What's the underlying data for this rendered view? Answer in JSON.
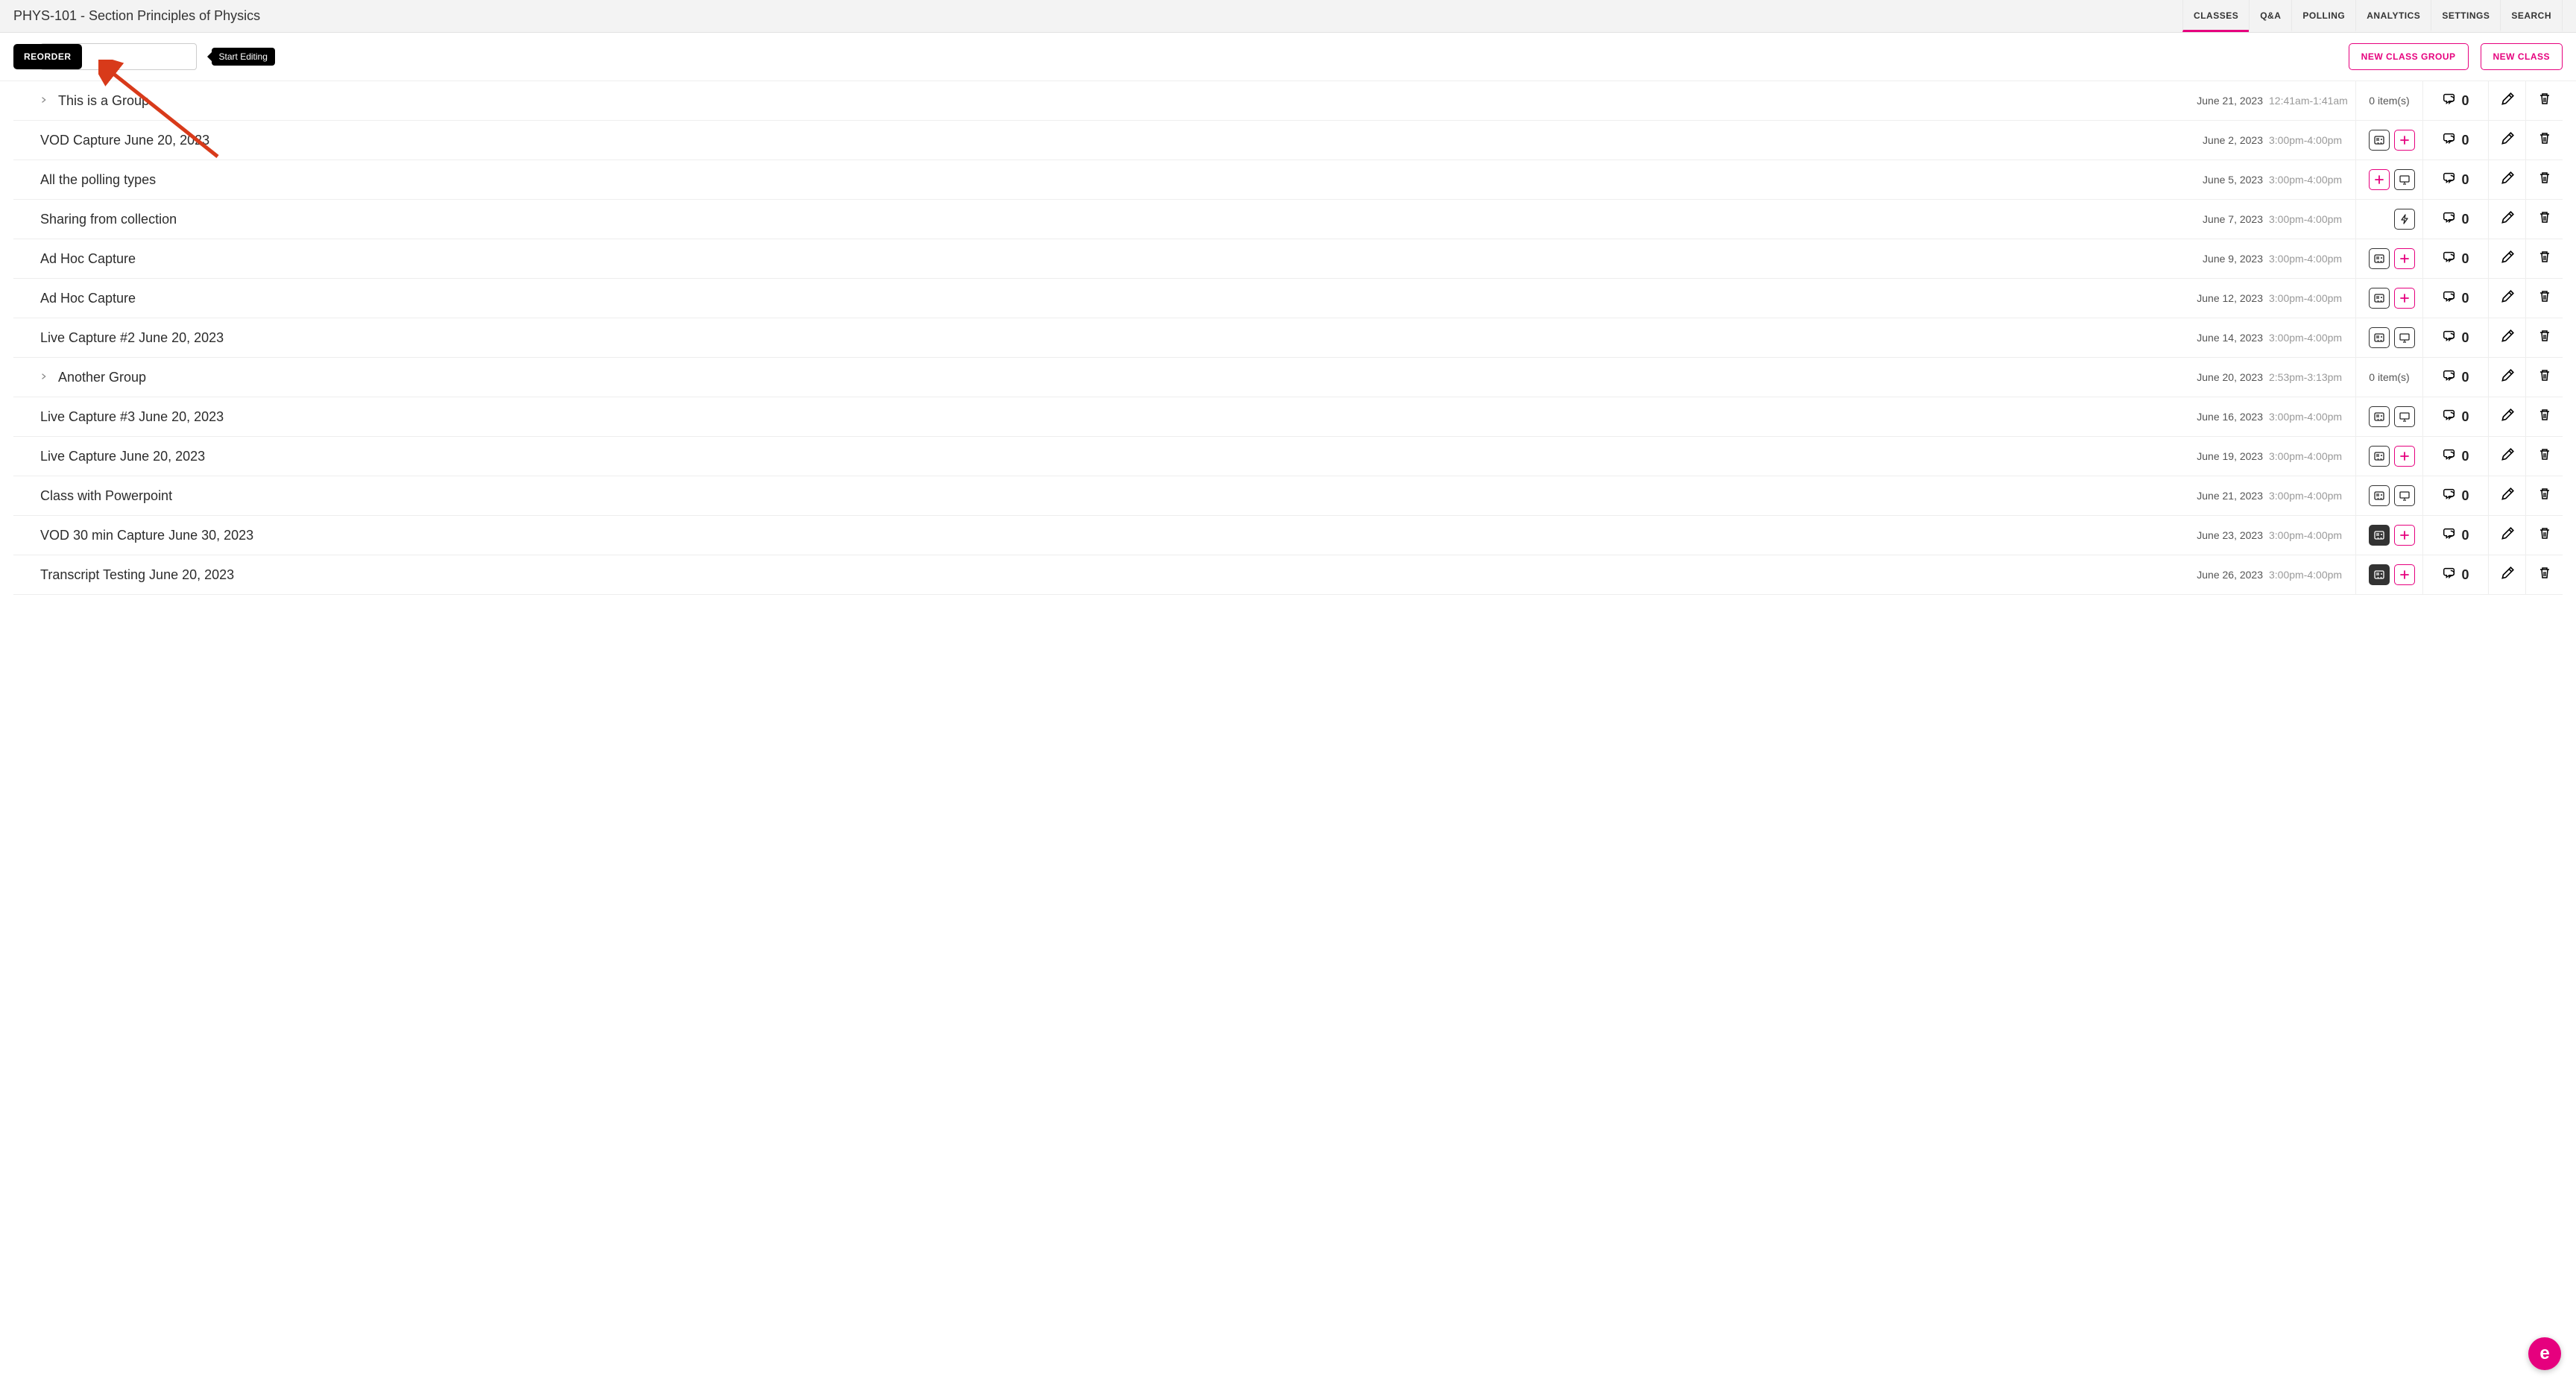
{
  "header": {
    "title": "PHYS-101 - Section Principles of Physics",
    "tabs": [
      {
        "label": "CLASSES",
        "active": true
      },
      {
        "label": "Q&A",
        "active": false
      },
      {
        "label": "POLLING",
        "active": false
      },
      {
        "label": "ANALYTICS",
        "active": false
      },
      {
        "label": "SETTINGS",
        "active": false
      },
      {
        "label": "SEARCH",
        "active": false
      }
    ]
  },
  "toolbar": {
    "reorder_label": "REORDER",
    "tooltip": "Start Editing",
    "search_value": "",
    "new_group_label": "NEW CLASS GROUP",
    "new_class_label": "NEW CLASS"
  },
  "fab_label": "e",
  "rows": [
    {
      "type": "group",
      "title": "This is a Group",
      "date": "June 21, 2023",
      "time": "12:41am-1:41am",
      "items": "0 item(s)",
      "comments": "0"
    },
    {
      "type": "class",
      "title": "VOD Capture June 20, 2023",
      "date": "June 2, 2023",
      "time": "3:00pm-4:00pm",
      "icons": [
        "media",
        "plus-pink"
      ],
      "comments": "0"
    },
    {
      "type": "class",
      "title": "All the polling types",
      "date": "June 5, 2023",
      "time": "3:00pm-4:00pm",
      "icons": [
        "plus-pink",
        "presentation"
      ],
      "comments": "0"
    },
    {
      "type": "class",
      "title": "Sharing from collection",
      "date": "June 7, 2023",
      "time": "3:00pm-4:00pm",
      "icons": [
        "lightning"
      ],
      "comments": "0"
    },
    {
      "type": "class",
      "title": "Ad Hoc Capture",
      "date": "June 9, 2023",
      "time": "3:00pm-4:00pm",
      "icons": [
        "media",
        "plus-pink"
      ],
      "comments": "0"
    },
    {
      "type": "class",
      "title": "Ad Hoc Capture",
      "date": "June 12, 2023",
      "time": "3:00pm-4:00pm",
      "icons": [
        "media",
        "plus-pink"
      ],
      "comments": "0"
    },
    {
      "type": "class",
      "title": "Live Capture #2 June 20, 2023",
      "date": "June 14, 2023",
      "time": "3:00pm-4:00pm",
      "icons": [
        "media",
        "presentation"
      ],
      "comments": "0"
    },
    {
      "type": "group",
      "title": "Another Group",
      "date": "June 20, 2023",
      "time": "2:53pm-3:13pm",
      "items": "0 item(s)",
      "comments": "0"
    },
    {
      "type": "class",
      "title": "Live Capture #3 June 20, 2023",
      "date": "June 16, 2023",
      "time": "3:00pm-4:00pm",
      "icons": [
        "media",
        "presentation"
      ],
      "comments": "0"
    },
    {
      "type": "class",
      "title": "Live Capture June 20, 2023",
      "date": "June 19, 2023",
      "time": "3:00pm-4:00pm",
      "icons": [
        "media",
        "plus-pink"
      ],
      "comments": "0"
    },
    {
      "type": "class",
      "title": "Class with Powerpoint",
      "date": "June 21, 2023",
      "time": "3:00pm-4:00pm",
      "icons": [
        "media",
        "presentation"
      ],
      "comments": "0"
    },
    {
      "type": "class",
      "title": "VOD 30 min Capture June 30, 2023",
      "date": "June 23, 2023",
      "time": "3:00pm-4:00pm",
      "icons": [
        "media-dark",
        "plus-pink"
      ],
      "comments": "0"
    },
    {
      "type": "class",
      "title": "Transcript Testing June 20, 2023",
      "date": "June 26, 2023",
      "time": "3:00pm-4:00pm",
      "icons": [
        "media-dark",
        "plus-pink"
      ],
      "comments": "0"
    }
  ]
}
